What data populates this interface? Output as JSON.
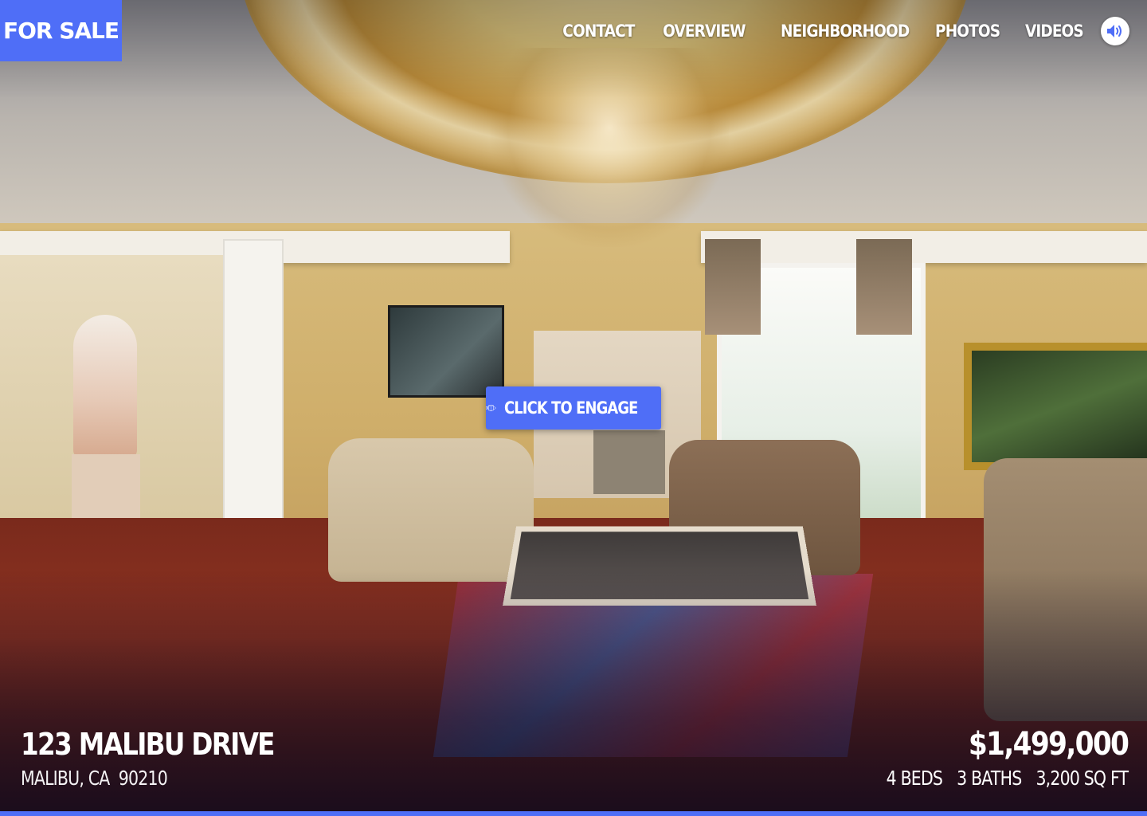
{
  "badge": {
    "label": "FOR SALE"
  },
  "nav": {
    "items": [
      {
        "label": "CONTACT"
      },
      {
        "label": "OVERVIEW"
      },
      {
        "label": "NEIGHBORHOOD"
      },
      {
        "label": "PHOTOS"
      },
      {
        "label": "VIDEOS"
      }
    ],
    "sound_icon": "speaker-icon"
  },
  "engage_button": {
    "icon": "3d-icon",
    "label": "CLICK TO ENGAGE"
  },
  "listing": {
    "street": "123 MALIBU DRIVE",
    "city": "MALIBU, CA  90210",
    "price": "$1,499,000",
    "beds": "4 BEDS",
    "baths": "3 BATHS",
    "sqft": "3,200 SQ FT"
  },
  "colors": {
    "accent": "#4f6ef7",
    "text": "#ffffff"
  }
}
